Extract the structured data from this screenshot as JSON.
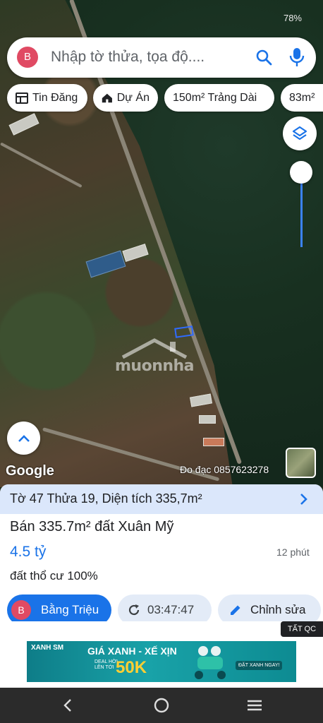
{
  "status_bar": {
    "time": "",
    "battery": "78%"
  },
  "search": {
    "avatar_letter": "B",
    "placeholder": "Nhập tờ thửa, tọa độ...."
  },
  "chips": [
    {
      "label": "Tin Đăng",
      "icon": "news-icon"
    },
    {
      "label": "Dự Án",
      "icon": "home-icon"
    },
    {
      "label": "150m² Trảng Dài"
    },
    {
      "label": "83m²"
    }
  ],
  "map": {
    "watermark": "muonnha",
    "google_label": "Google",
    "survey_contact": "Đo đạc 0857623278",
    "opacity_level": 0.85,
    "colors": {
      "accent": "#1a73e8",
      "parcel_outline": "#2f6bff"
    }
  },
  "listing": {
    "plot_info": "Tờ 47 Thửa 19, Diện tích 335,7m²",
    "title": "Bán 335.7m² đất Xuân Mỹ",
    "price": "4.5 tỷ",
    "time_ago": "12 phút",
    "note": "đất thổ cư 100%",
    "user": {
      "avatar_letter": "B",
      "name": "Bằng Triệu"
    },
    "refresh_time": "03:47:47",
    "edit_label": "Chỉnh sửa"
  },
  "ad": {
    "label": "TẤT QC",
    "brand": "XANH SM",
    "headline": "GIÁ XANH - XẾ XỊN",
    "deal_line1": "DEAL HỜI",
    "deal_line2": "LÊN TỚI",
    "amount": "50K",
    "cta": "ĐẶT XANH NGAY!"
  },
  "nav": {
    "back": "back-icon",
    "home": "home-circle-icon",
    "recents": "recents-icon"
  }
}
